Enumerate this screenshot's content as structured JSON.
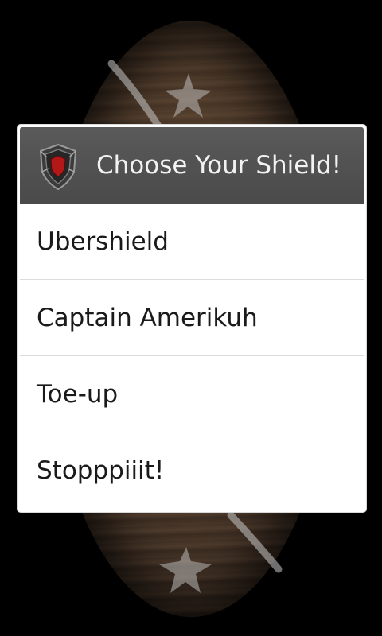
{
  "dialog": {
    "title": "Choose Your Shield!",
    "title_icon": "shield-icon",
    "items": [
      {
        "label": "Ubershield"
      },
      {
        "label": "Captain Amerikuh"
      },
      {
        "label": "Toe-up"
      },
      {
        "label": "Stopppiiit!"
      }
    ]
  },
  "colors": {
    "title_bar": "#4f4f4f",
    "background": "#000000",
    "dialog_body": "#ffffff"
  }
}
